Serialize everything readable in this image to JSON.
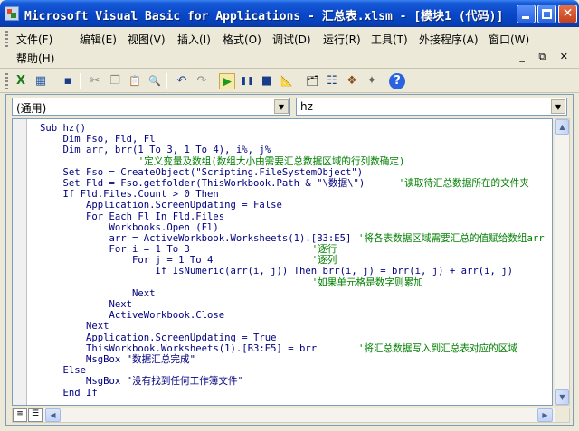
{
  "window": {
    "title": "Microsoft Visual Basic for Applications - 汇总表.xlsm - [模块1 (代码)]",
    "min_label": "",
    "max_label": "",
    "close_label": "✕"
  },
  "menu": {
    "items": [
      {
        "label": "文件(F)"
      },
      {
        "label": "编辑(E)"
      },
      {
        "label": "视图(V)"
      },
      {
        "label": "插入(I)"
      },
      {
        "label": "格式(O)"
      },
      {
        "label": "调试(D)"
      },
      {
        "label": "运行(R)"
      },
      {
        "label": "工具(T)"
      },
      {
        "label": "外接程序(A)"
      },
      {
        "label": "窗口(W)"
      },
      {
        "label": "帮助(H)"
      }
    ],
    "mdi_controls": "_ ⧉ ✕"
  },
  "toolbar": {
    "icons": [
      "excel-icon",
      "insert-module-icon",
      "save-icon",
      "cut-icon",
      "copy-icon",
      "paste-icon",
      "find-icon",
      "undo-icon",
      "redo-icon",
      "run-icon",
      "break-icon",
      "reset-icon",
      "design-mode-icon",
      "project-explorer-icon",
      "properties-icon",
      "object-browser-icon",
      "toolbox-icon",
      "help-icon"
    ],
    "glyphs": [
      "X",
      "▦",
      "▪",
      "✂",
      "❐",
      "📋",
      "🔍",
      "↶",
      "↷",
      "▶",
      "❚❚",
      "■",
      "📐",
      "🗂",
      "☷",
      "❖",
      "✦",
      "?"
    ]
  },
  "code_window": {
    "object_combo": "(通用)",
    "procedure_combo": "hz",
    "lines": [
      {
        "code": "Sub hz()",
        "comment": ""
      },
      {
        "code": "    Dim Fso, Fld, Fl",
        "comment": ""
      },
      {
        "code": "    Dim arr, brr(1 To 3, 1 To 4), i%, j%",
        "comment": ""
      },
      {
        "code": "",
        "comment": "'定义变量及数组(数组大小由需要汇总数据区域的行列数确定)",
        "cpad": 17
      },
      {
        "code": "    Set Fso = CreateObject(\"Scripting.FileSystemObject\")",
        "comment": ""
      },
      {
        "code": "    Set Fld = Fso.getfolder(ThisWorkbook.Path & \"\\数据\\\")",
        "comment": "'读取待汇总数据所在的文件夹",
        "cpad": 62
      },
      {
        "code": "    If Fld.Files.Count > 0 Then",
        "comment": ""
      },
      {
        "code": "        Application.ScreenUpdating = False",
        "comment": ""
      },
      {
        "code": "        For Each Fl In Fld.Files",
        "comment": ""
      },
      {
        "code": "            Workbooks.Open (Fl)",
        "comment": ""
      },
      {
        "code": "            arr = ActiveWorkbook.Worksheets(1).[B3:E5]",
        "comment": "'将各表数据区域需要汇总的值赋给数组arr",
        "cpad": 55
      },
      {
        "code": "            For i = 1 To 3",
        "comment": "'逐行",
        "cpad": 47
      },
      {
        "code": "                For j = 1 To 4",
        "comment": "'逐列",
        "cpad": 47
      },
      {
        "code": "                    If IsNumeric(arr(i, j)) Then brr(i, j) = brr(i, j) + arr(i, j)",
        "comment": ""
      },
      {
        "code": "",
        "comment": "'如果单元格是数字则累加",
        "cpad": 47
      },
      {
        "code": "                Next",
        "comment": ""
      },
      {
        "code": "            Next",
        "comment": ""
      },
      {
        "code": "            ActiveWorkbook.Close",
        "comment": ""
      },
      {
        "code": "        Next",
        "comment": ""
      },
      {
        "code": "        Application.ScreenUpdating = True",
        "comment": ""
      },
      {
        "code": "        ThisWorkbook.Worksheets(1).[B3:E5] = brr",
        "comment": "'将汇总数据写入到汇总表对应的区域",
        "cpad": 55
      },
      {
        "code": "        MsgBox \"数据汇总完成\"",
        "comment": ""
      },
      {
        "code": "    Else",
        "comment": ""
      },
      {
        "code": "        MsgBox \"没有找到任何工作簿文件\"",
        "comment": ""
      },
      {
        "code": "    End If",
        "comment": ""
      },
      {
        "code": "",
        "comment": ""
      },
      {
        "code": "End Sub",
        "comment": ""
      }
    ]
  }
}
